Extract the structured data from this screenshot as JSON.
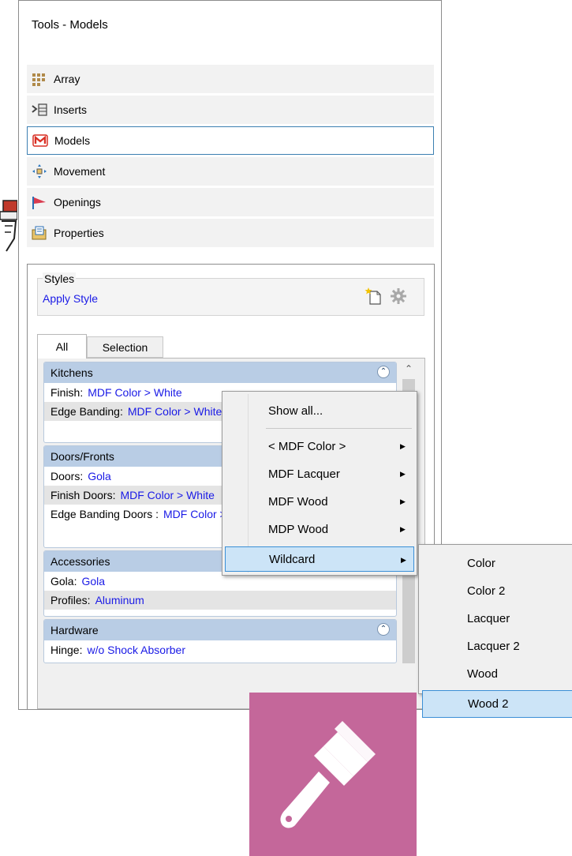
{
  "panel": {
    "title": "Tools - Models"
  },
  "tools": [
    {
      "label": "Array",
      "icon": "array-grid-icon"
    },
    {
      "label": "Inserts",
      "icon": "inserts-icon"
    },
    {
      "label": "Models",
      "icon": "models-m-icon",
      "selected": true
    },
    {
      "label": "Movement",
      "icon": "movement-arrows-icon"
    },
    {
      "label": "Openings",
      "icon": "openings-flag-icon"
    },
    {
      "label": "Properties",
      "icon": "properties-folder-icon"
    }
  ],
  "styles": {
    "label": "Styles",
    "apply_label": "Apply Style"
  },
  "tabs": [
    {
      "label": "All",
      "active": true
    },
    {
      "label": "Selection"
    }
  ],
  "groups": {
    "kitchens": {
      "title": "Kitchens",
      "rows": [
        {
          "key": "Finish:",
          "value": "MDF Color > White"
        },
        {
          "key": "Edge Banding:",
          "value": "MDF Color > White"
        }
      ]
    },
    "doors": {
      "title": "Doors/Fronts",
      "rows": [
        {
          "key": "Doors:",
          "value": "Gola"
        },
        {
          "key": "Finish Doors:",
          "value": "MDF Color > White"
        },
        {
          "key": "Edge Banding Doors :",
          "value": "MDF Color > White"
        }
      ]
    },
    "accessories": {
      "title": "Accessories",
      "rows": [
        {
          "key": "Gola:",
          "value": "Gola"
        },
        {
          "key": "Profiles:",
          "value": "Aluminum"
        }
      ]
    },
    "hardware": {
      "title": "Hardware",
      "rows": [
        {
          "key": "Hinge:",
          "value": "w/o Shock Absorber"
        }
      ]
    }
  },
  "context_menu": {
    "items": [
      {
        "label": "Show all..."
      },
      {
        "label": "< MDF Color >",
        "submenu": true
      },
      {
        "label": "MDF Lacquer",
        "submenu": true
      },
      {
        "label": "MDF Wood",
        "submenu": true
      },
      {
        "label": "MDP Wood",
        "submenu": true
      },
      {
        "label": "Wildcard",
        "submenu": true,
        "highlighted": true
      }
    ]
  },
  "submenu": {
    "items": [
      {
        "label": "Color"
      },
      {
        "label": "Color 2"
      },
      {
        "label": "Lacquer"
      },
      {
        "label": "Lacquer 2"
      },
      {
        "label": "Wood"
      },
      {
        "label": "Wood 2",
        "highlighted": true
      }
    ]
  },
  "colors": {
    "accent_blue_text": "#1a1ae6",
    "group_header": "#b9cde5",
    "highlight": "#cce4f7",
    "highlight_border": "#3b8fd6",
    "brush_tile": "#c4679a"
  }
}
